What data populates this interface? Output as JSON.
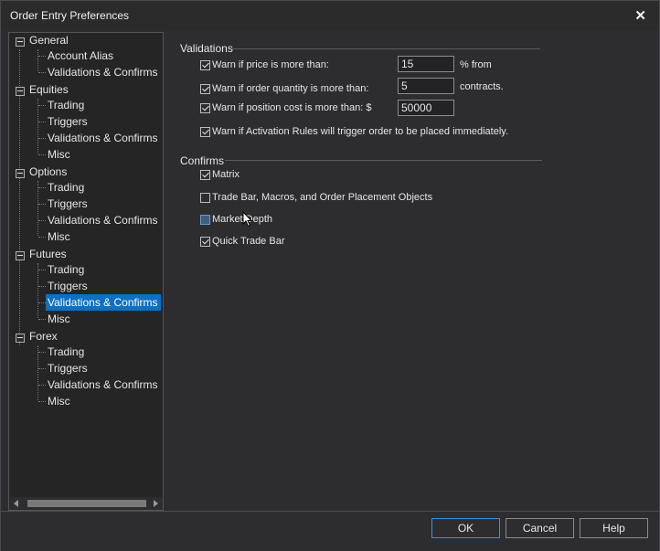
{
  "window": {
    "title": "Order Entry Preferences",
    "close_symbol": "✕"
  },
  "tree": {
    "groups": [
      {
        "label": "General",
        "children": [
          "Account Alias",
          "Validations & Confirms"
        ]
      },
      {
        "label": "Equities",
        "children": [
          "Trading",
          "Triggers",
          "Validations & Confirms",
          "Misc"
        ]
      },
      {
        "label": "Options",
        "children": [
          "Trading",
          "Triggers",
          "Validations & Confirms",
          "Misc"
        ]
      },
      {
        "label": "Futures",
        "children": [
          "Trading",
          "Triggers",
          "Validations & Confirms",
          "Misc"
        ]
      },
      {
        "label": "Forex",
        "children": [
          "Trading",
          "Triggers",
          "Validations & Confirms",
          "Misc"
        ]
      }
    ],
    "selected": "Futures > Validations & Confirms"
  },
  "validations": {
    "heading": "Validations",
    "price": {
      "label": "Warn if price is more than:",
      "value": "15",
      "suffix": "% from",
      "checked": true
    },
    "quantity": {
      "label": "Warn if order quantity is more than:",
      "value": "5",
      "suffix": "contracts.",
      "checked": true
    },
    "position": {
      "label": "Warn if position cost is more than: $",
      "value": "50000",
      "checked": true
    },
    "activation": {
      "label": "Warn if Activation Rules will trigger order to be placed immediately.",
      "checked": true
    }
  },
  "confirms": {
    "heading": "Confirms",
    "items": [
      {
        "label": "Matrix",
        "checked": true
      },
      {
        "label": "Trade Bar, Macros, and Order Placement Objects",
        "checked": false
      },
      {
        "label": "Market Depth",
        "checked": false
      },
      {
        "label": "Quick Trade Bar",
        "checked": true
      }
    ]
  },
  "buttons": {
    "ok": "OK",
    "cancel": "Cancel",
    "help": "Help"
  },
  "colors": {
    "selection": "#0e70c0",
    "background": "#2d2d30",
    "default_button_border": "#3f8fd8"
  }
}
